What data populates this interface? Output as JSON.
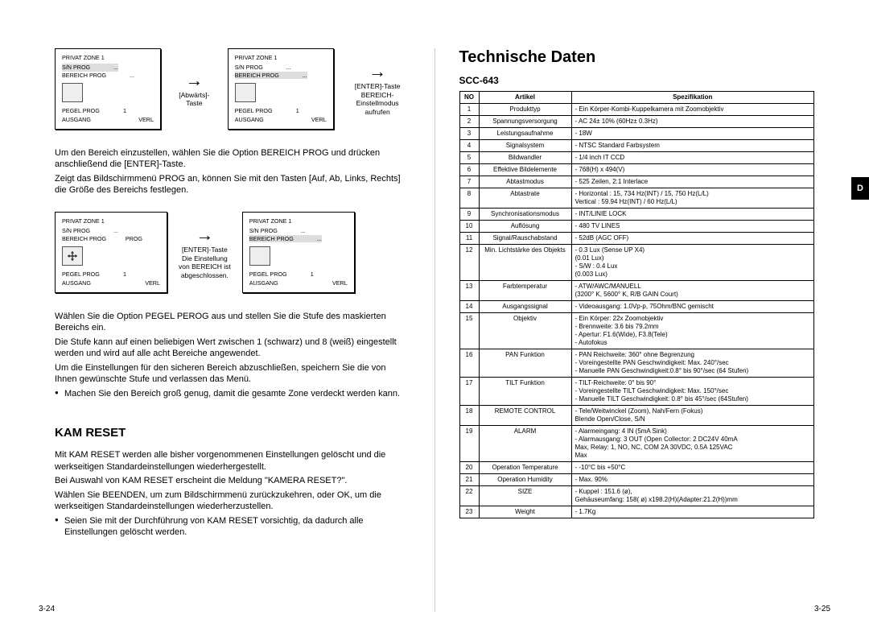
{
  "leftPage": {
    "pageNum": "3-24",
    "osdRow1": {
      "box1": {
        "title": "PRIVAT ZONE 1",
        "l1a": "S/N PROG",
        "l1b": "...",
        "l2a": "BEREICH PROG",
        "l2b": "...",
        "b1a": "PEGEL PROG",
        "b1b": "1",
        "b2a": "AUSGANG",
        "b2b": "VERL"
      },
      "cap1": "[Abwärts]-Taste",
      "box2": {
        "title": "PRIVAT ZONE 1",
        "l1a": "S/N PROG",
        "l1b": "...",
        "l2a": "BEREICH PROG",
        "l2b": "...",
        "b1a": "PEGEL PROG",
        "b1b": "1",
        "b2a": "AUSGANG",
        "b2b": "VERL"
      },
      "cap2a": "[ENTER]-Taste",
      "cap2b": "BEREICH-",
      "cap2c": "Einstellmodus aufrufen"
    },
    "para1a": "Um den Bereich einzustellen, wählen Sie die Option BEREICH PROG und drücken anschließend die [ENTER]-Taste.",
    "para1b": "Zeigt das Bildschirmmenü PROG an, können Sie mit den Tasten [Auf, Ab, Links, Rechts] die Größe des Bereichs festlegen.",
    "osdRow2": {
      "box1": {
        "title": "PRIVAT ZONE 1",
        "l1a": "S/N PROG",
        "l1b": "...",
        "l2a": "BEREICH PROG",
        "l2b": "PROG",
        "b1a": "PEGEL PROG",
        "b1b": "1",
        "b2a": "AUSGANG",
        "b2b": "VERL"
      },
      "cap1a": "[ENTER]-Taste",
      "cap1b": "Die Einstellung",
      "cap1c": "von BEREICH ist",
      "cap1d": "abgeschlossen.",
      "box2": {
        "title": "PRIVAT ZONE 1",
        "l1a": "S/N PROG",
        "l1b": "...",
        "l2a": "BEREICH PROG",
        "l2b": "...",
        "b1a": "PEGEL PROG",
        "b1b": "1",
        "b2a": "AUSGANG",
        "b2b": "VERL"
      }
    },
    "para2a": "Wählen Sie die Option PEGEL PEROG aus und stellen Sie die Stufe des maskierten Bereichs ein.",
    "para2b": "Die Stufe kann auf einen beliebigen Wert zwischen 1 (schwarz) und 8 (weiß) eingestellt werden und wird auf alle acht Bereiche angewendet.",
    "para2c": "Um die Einstellungen für den sicheren Bereich abzuschließen, speichern Sie die von Ihnen gewünschte Stufe und verlassen das Menü.",
    "bullet2": "Machen Sie den Bereich groß genug, damit die gesamte Zone verdeckt werden kann.",
    "kamReset": {
      "heading": "KAM RESET",
      "p1": "Mit KAM RESET werden alle bisher vorgenommenen Einstellungen gelöscht und die werkseitigen Standardeinstellungen wiederhergestellt.",
      "p2": "Bei Auswahl von KAM RESET erscheint die Meldung \"KAMERA RESET?\".",
      "p3": "Wählen Sie BEENDEN, um zum Bildschirmmenü zurückzukehren, oder OK, um die werkseitigen Standardeinstellungen wiederherzustellen.",
      "bullet": "Seien Sie mit der Durchführung von KAM RESET vorsichtig, da dadurch alle Einstellungen gelöscht werden."
    }
  },
  "rightPage": {
    "pageNum": "3-25",
    "heading": "Technische Daten",
    "model": "SCC-643",
    "thNo": "NO",
    "thArtikel": "Artikel",
    "thSpez": "Spezifikation",
    "rows": [
      {
        "no": "1",
        "a": "Produkttyp",
        "s": "- Ein Körper-Kombi-Kuppelkamera mit Zoomobjektiv"
      },
      {
        "no": "2",
        "a": "Spannungsversorgung",
        "s": "- AC 24± 10% (60Hz± 0.3Hz)"
      },
      {
        "no": "3",
        "a": "Leistungsaufnahme",
        "s": "- 18W"
      },
      {
        "no": "4",
        "a": "Signalsystem",
        "s": "- NTSC Standard Farbsystem"
      },
      {
        "no": "5",
        "a": "Bildwandler",
        "s": "- 1/4 inch IT CCD"
      },
      {
        "no": "6",
        "a": "Effektive Bildelemente",
        "s": "- 768(H) x 494(V)"
      },
      {
        "no": "7",
        "a": "Abtastmodus",
        "s": "- 525 Zeilen, 2:1 Interlace"
      },
      {
        "no": "8",
        "a": "Abtastrate",
        "s": "- Horizontal : 15, 734 Hz(INT) / 15, 750 Hz(L/L)\n  Vertical    : 59.94 Hz(INT) / 60 Hz(L/L)"
      },
      {
        "no": "9",
        "a": "Synchronisationsmodus",
        "s": "- INT/LINIE LOCK"
      },
      {
        "no": "10",
        "a": "Auflösung",
        "s": "- 480 TV LINES"
      },
      {
        "no": "11",
        "a": "Signal/Rauschabstand",
        "s": "- 52dB (AGC OFF)"
      },
      {
        "no": "12",
        "a": "Min. Lichtstärke des Objekts",
        "s": "- 0.3 Lux (Sense UP X4)\n    (0.01 Lux)\n- S/W : 0.4 Lux\n    (0.003 Lux)"
      },
      {
        "no": "13",
        "a": "Farbtemperatur",
        "s": "- ATW/AWC/MANUELL\n  (3200° K, 5600° K, R/B GAIN Court)"
      },
      {
        "no": "14",
        "a": "Ausgangssignal",
        "s": "- Videoausgang: 1.0Vp-p, 75Ohm/BNC gemischt"
      },
      {
        "no": "15",
        "a": "Objektiv",
        "s": "- Ein Körper: 22x Zoomobjektiv\n- Brennweite: 3.6 bis 79.2mm\n- Apertur: F1.6(Wide), F3.8(Tele)\n- Autofokus"
      },
      {
        "no": "16",
        "a": "PAN Funktion",
        "s": "- PAN Reichweite: 360° ohne Begrenzung\n- Voreingestellte PAN Geschwindigkeit: Max. 240°/sec\n- Manuelle PAN Geschwindigkeit:0.8° bis 90°/sec (64 Stufen)"
      },
      {
        "no": "17",
        "a": "TILT Funktion",
        "s": "- TILT-Reichweite: 0° bis 90°\n- Voreingestellte TILT Geschwindigkeit: Max. 150°/sec\n- Manuelle TILT Geschwindigkeit: 0.8° bis 45°/sec (64Stufen)"
      },
      {
        "no": "18",
        "a": "REMOTE CONTROL",
        "s": "- Tele/Weitwinckel (Zoom), Nah/Fern (Fokus)\n  Blende Open/Close, S/N"
      },
      {
        "no": "19",
        "a": "ALARM",
        "s": "- Alarmeingang: 4 IN (5mA Sink)\n- Alarmausgang: 3 OUT (Open Collector: 2 DC24V 40mA\n  Max, Relay: 1, NO, NC, COM 2A 30VDC, 0.5A 125VAC\n  Max"
      },
      {
        "no": "20",
        "a": "Operation Temperature",
        "s": "- -10°C bis +50°C"
      },
      {
        "no": "21",
        "a": "Operation Humidity",
        "s": "- Max. 90%"
      },
      {
        "no": "22",
        "a": "SIZE",
        "s": "- Kuppel : 151.6 (ø),\n  Gehäuseumfang: 158( ø) x198.2(H)(Adapter:21.2(H))mm"
      },
      {
        "no": "23",
        "a": "Weight",
        "s": "- 1.7Kg"
      }
    ]
  },
  "sideTab": "D"
}
